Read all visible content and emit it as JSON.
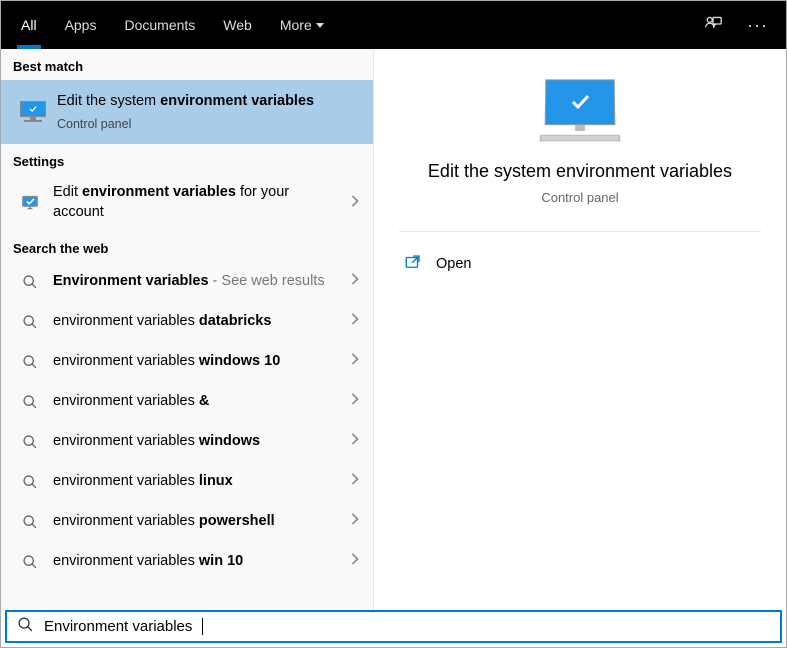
{
  "topbar": {
    "tabs": {
      "all": "All",
      "apps": "Apps",
      "documents": "Documents",
      "web": "Web",
      "more": "More"
    }
  },
  "left": {
    "best_match_header": "Best match",
    "best_match": {
      "title_pre": "Edit the system ",
      "title_bold1": "environment",
      "title_mid": " ",
      "title_bold2": "variables",
      "subtitle": "Control panel"
    },
    "settings_header": "Settings",
    "settings_item": {
      "pre": "Edit ",
      "bold": "environment variables",
      "post": " for your account"
    },
    "web_header": "Search the web",
    "web_items": [
      {
        "pre": "",
        "bold": "Environment variables",
        "post": "",
        "suffix": " - See web results"
      },
      {
        "pre": "environment variables ",
        "bold": "databricks",
        "post": ""
      },
      {
        "pre": "environment variables ",
        "bold": "windows 10",
        "post": ""
      },
      {
        "pre": "environment variables ",
        "bold": "&",
        "post": ""
      },
      {
        "pre": "environment variables ",
        "bold": "windows",
        "post": ""
      },
      {
        "pre": "environment variables ",
        "bold": "linux",
        "post": ""
      },
      {
        "pre": "environment variables ",
        "bold": "powershell",
        "post": ""
      },
      {
        "pre": "environment variables ",
        "bold": "win 10",
        "post": ""
      }
    ]
  },
  "preview": {
    "title": "Edit the system environment variables",
    "subtitle": "Control panel",
    "open": "Open"
  },
  "search": {
    "value": "Environment variables"
  }
}
